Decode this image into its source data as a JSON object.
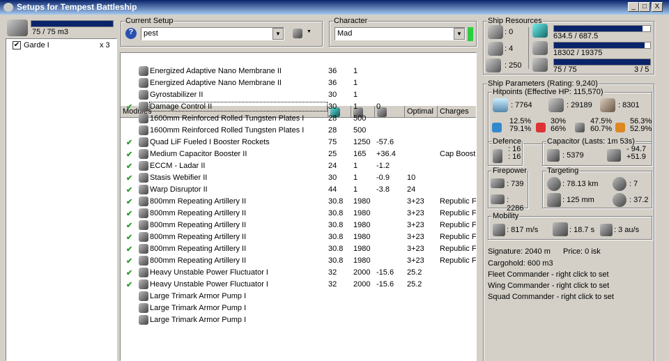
{
  "window": {
    "title": "Setups for Tempest Battleship",
    "min": "_",
    "max": "□",
    "close": "X"
  },
  "drones": {
    "bay": "75 / 75 m3",
    "bay_fill": 1.0,
    "items": [
      {
        "name": "Garde I",
        "count": "x 3",
        "checked": true
      }
    ]
  },
  "setup": {
    "label": "Current Setup",
    "value": "pest"
  },
  "character": {
    "label": "Character",
    "value": "Mad"
  },
  "columns": [
    "Modules",
    "",
    "",
    "",
    "Optimal",
    "Charges"
  ],
  "modules": [
    {
      "name": "Energized Adaptive Nano Membrane II",
      "active": false,
      "cpu": "36",
      "pg": "1",
      "cap": "",
      "opt": "",
      "charge": ""
    },
    {
      "name": "Energized Adaptive Nano Membrane II",
      "active": false,
      "cpu": "36",
      "pg": "1",
      "cap": "",
      "opt": "",
      "charge": ""
    },
    {
      "name": "Gyrostabilizer II",
      "active": false,
      "cpu": "30",
      "pg": "1",
      "cap": "",
      "opt": "",
      "charge": ""
    },
    {
      "name": "Damage Control II",
      "active": true,
      "cpu": "30",
      "pg": "1",
      "cap": "0",
      "opt": "",
      "charge": ""
    },
    {
      "name": "1600mm Reinforced Rolled Tungsten Plates I",
      "active": false,
      "cpu": "28",
      "pg": "500",
      "cap": "",
      "opt": "",
      "charge": ""
    },
    {
      "name": "1600mm Reinforced Rolled Tungsten Plates I",
      "active": false,
      "cpu": "28",
      "pg": "500",
      "cap": "",
      "opt": "",
      "charge": ""
    },
    {
      "name": "Quad LiF Fueled I Booster Rockets",
      "active": true,
      "cpu": "75",
      "pg": "1250",
      "cap": "-57.6",
      "opt": "",
      "charge": ""
    },
    {
      "name": "Medium Capacitor Booster II",
      "active": true,
      "cpu": "25",
      "pg": "165",
      "cap": "+36.4",
      "opt": "",
      "charge": "Cap Booster"
    },
    {
      "name": "ECCM - Ladar II",
      "active": true,
      "cpu": "24",
      "pg": "1",
      "cap": "-1.2",
      "opt": "",
      "charge": ""
    },
    {
      "name": "Stasis Webifier II",
      "active": true,
      "cpu": "30",
      "pg": "1",
      "cap": "-0.9",
      "opt": "10",
      "charge": ""
    },
    {
      "name": "Warp Disruptor II",
      "active": true,
      "cpu": "44",
      "pg": "1",
      "cap": "-3.8",
      "opt": "24",
      "charge": ""
    },
    {
      "name": "800mm Repeating Artillery II",
      "active": true,
      "cpu": "30.8",
      "pg": "1980",
      "cap": "",
      "opt": "3+23",
      "charge": "Republic Fleet"
    },
    {
      "name": "800mm Repeating Artillery II",
      "active": true,
      "cpu": "30.8",
      "pg": "1980",
      "cap": "",
      "opt": "3+23",
      "charge": "Republic Fleet"
    },
    {
      "name": "800mm Repeating Artillery II",
      "active": true,
      "cpu": "30.8",
      "pg": "1980",
      "cap": "",
      "opt": "3+23",
      "charge": "Republic Fleet"
    },
    {
      "name": "800mm Repeating Artillery II",
      "active": true,
      "cpu": "30.8",
      "pg": "1980",
      "cap": "",
      "opt": "3+23",
      "charge": "Republic Fleet"
    },
    {
      "name": "800mm Repeating Artillery II",
      "active": true,
      "cpu": "30.8",
      "pg": "1980",
      "cap": "",
      "opt": "3+23",
      "charge": "Republic Fleet"
    },
    {
      "name": "800mm Repeating Artillery II",
      "active": true,
      "cpu": "30.8",
      "pg": "1980",
      "cap": "",
      "opt": "3+23",
      "charge": "Republic Fleet"
    },
    {
      "name": "Heavy Unstable Power Fluctuator I",
      "active": true,
      "cpu": "32",
      "pg": "2000",
      "cap": "-15.6",
      "opt": "25.2",
      "charge": ""
    },
    {
      "name": "Heavy Unstable Power Fluctuator I",
      "active": true,
      "cpu": "32",
      "pg": "2000",
      "cap": "-15.6",
      "opt": "25.2",
      "charge": ""
    },
    {
      "name": "Large Trimark Armor Pump I",
      "active": false,
      "cpu": "",
      "pg": "",
      "cap": "",
      "opt": "",
      "charge": ""
    },
    {
      "name": "Large Trimark Armor Pump I",
      "active": false,
      "cpu": "",
      "pg": "",
      "cap": "",
      "opt": "",
      "charge": ""
    },
    {
      "name": "Large Trimark Armor Pump I",
      "active": false,
      "cpu": "",
      "pg": "",
      "cap": "",
      "opt": "",
      "charge": ""
    }
  ],
  "resources": {
    "label": "Ship Resources",
    "hardpoints": [
      ": 0",
      ": 4",
      ": 250"
    ],
    "cpu": "634.5 / 687.5",
    "cpu_fill": 0.923,
    "pg": "18302 / 19375",
    "pg_fill": 0.945,
    "drone_bw": "75 / 75",
    "drone_bw_fill": 1.0,
    "drones_active": "3 / 5"
  },
  "params": {
    "label": "Ship Parameters (Rating: 9,240)",
    "hp": {
      "label": "Hitpoints (Effective HP: 115,570)",
      "shield": ": 7764",
      "armor": ": 29189",
      "hull": ": 8301",
      "resists": [
        [
          "12.5%",
          "79.1%"
        ],
        [
          "30%",
          "66%"
        ],
        [
          "47.5%",
          "60.7%"
        ],
        [
          "56.3%",
          "52.9%"
        ]
      ]
    },
    "defence": {
      "label": "Defence",
      "a": ": 16",
      "b": ": 16"
    },
    "capacitor": {
      "label": "Capacitor (Lasts: 1m 53s)",
      "amount": ": 5379",
      "a": "- 94.7",
      "b": "+51.9"
    },
    "firepower": {
      "label": "Firepower",
      "a": ": 739",
      "b": ": 2286"
    },
    "targeting": {
      "label": "Targeting",
      "range": ": 78.13 km",
      "targets": ": 7",
      "res": ": 125 mm",
      "sensor": ": 37.2"
    },
    "mobility": {
      "label": "Mobility",
      "speed": ": 817 m/s",
      "align": ": 18.7 s",
      "warp": ": 3 au/s"
    },
    "signature": "Signature: 2040 m",
    "price": "Price: 0 isk",
    "cargo": "Cargohold: 600 m3",
    "fleet": "Fleet Commander - right click to set",
    "wing": "Wing Commander - right click to set",
    "squad": "Squad Commander - right click to set"
  }
}
